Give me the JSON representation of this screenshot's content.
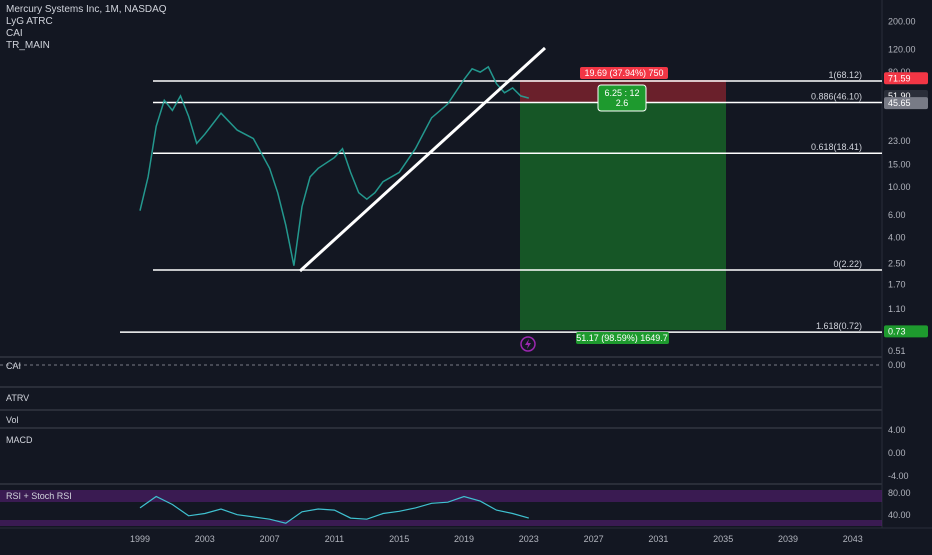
{
  "header": {
    "title": "Mercury Systems Inc, 1M, NASDAQ",
    "indicators": [
      "LyG ATRC",
      "CAI",
      "TR_MAIN"
    ]
  },
  "colors": {
    "background": "#131722",
    "red_zone": "#b22833",
    "green_zone": "#1a8a2a",
    "price_badge_red": "#f23645",
    "price_badge_green": "#1e9a2e",
    "trendline": "#ffffff",
    "rsi": "#3fc1d0",
    "overbought_band": "#5b1f7a"
  },
  "chart_data": {
    "type": "line",
    "x_ticks": [
      "1999",
      "2003",
      "2007",
      "2011",
      "2015",
      "2019",
      "2023",
      "2027",
      "2031",
      "2035",
      "2039",
      "2043"
    ],
    "y_ticks": [
      "200.00",
      "120.00",
      "80.00",
      "51.90",
      "45.65",
      "23.00",
      "15.00",
      "10.00",
      "6.00",
      "4.00",
      "2.50",
      "1.70",
      "1.10",
      "0.51"
    ],
    "y_scale": "log",
    "price_markers": [
      "71.59",
      "51.90",
      "45.65",
      "0.73"
    ],
    "fib_levels": [
      {
        "label": "1(68.12)",
        "value": 68.12
      },
      {
        "label": "0.886(46.10)",
        "value": 46.1
      },
      {
        "label": "0.618(18.41)",
        "value": 18.41
      },
      {
        "label": "0(2.22)",
        "value": 2.22
      },
      {
        "label": "1.618(0.72)",
        "value": 0.72
      }
    ],
    "position_labels": {
      "stop": "19.69 (37.94%) 750",
      "ratio_line1": "6.25 : 12",
      "ratio_line2": "2.6",
      "target": "51.17 (98.59%) 1649.7"
    },
    "price_path": [
      {
        "x": 1999.0,
        "y": 6.5
      },
      {
        "x": 1999.5,
        "y": 12
      },
      {
        "x": 2000.0,
        "y": 30
      },
      {
        "x": 2000.5,
        "y": 48
      },
      {
        "x": 2001.0,
        "y": 40
      },
      {
        "x": 2001.5,
        "y": 52
      },
      {
        "x": 2002.0,
        "y": 36
      },
      {
        "x": 2002.5,
        "y": 22
      },
      {
        "x": 2003.0,
        "y": 26
      },
      {
        "x": 2004.0,
        "y": 38
      },
      {
        "x": 2005.0,
        "y": 28
      },
      {
        "x": 2006.0,
        "y": 24
      },
      {
        "x": 2007.0,
        "y": 14
      },
      {
        "x": 2007.5,
        "y": 9
      },
      {
        "x": 2008.0,
        "y": 5
      },
      {
        "x": 2008.5,
        "y": 2.4
      },
      {
        "x": 2009.0,
        "y": 7
      },
      {
        "x": 2009.5,
        "y": 12
      },
      {
        "x": 2010.0,
        "y": 14
      },
      {
        "x": 2011.0,
        "y": 17
      },
      {
        "x": 2011.5,
        "y": 20
      },
      {
        "x": 2012.0,
        "y": 13
      },
      {
        "x": 2012.5,
        "y": 9
      },
      {
        "x": 2013.0,
        "y": 8
      },
      {
        "x": 2013.5,
        "y": 9
      },
      {
        "x": 2014.0,
        "y": 11
      },
      {
        "x": 2015.0,
        "y": 13
      },
      {
        "x": 2016.0,
        "y": 20
      },
      {
        "x": 2017.0,
        "y": 35
      },
      {
        "x": 2018.0,
        "y": 45
      },
      {
        "x": 2019.0,
        "y": 70
      },
      {
        "x": 2019.5,
        "y": 85
      },
      {
        "x": 2020.0,
        "y": 80
      },
      {
        "x": 2020.5,
        "y": 88
      },
      {
        "x": 2021.0,
        "y": 65
      },
      {
        "x": 2021.5,
        "y": 55
      },
      {
        "x": 2022.0,
        "y": 60
      },
      {
        "x": 2022.5,
        "y": 52
      },
      {
        "x": 2023.0,
        "y": 50
      }
    ],
    "subpanes": [
      {
        "name": "CAI",
        "ticks": [
          "0.00"
        ]
      },
      {
        "name": "ATRV",
        "ticks": []
      },
      {
        "name": "Vol",
        "ticks": []
      },
      {
        "name": "MACD",
        "ticks": [
          "4.00",
          "0.00",
          "-4.00"
        ]
      },
      {
        "name": "RSI + Stoch RSI",
        "ticks": [
          "80.00",
          "40.00"
        ]
      }
    ],
    "rsi_values": [
      {
        "x": 1999.0,
        "y": 62
      },
      {
        "x": 2000.0,
        "y": 82
      },
      {
        "x": 2001.0,
        "y": 68
      },
      {
        "x": 2002.0,
        "y": 48
      },
      {
        "x": 2003.0,
        "y": 52
      },
      {
        "x": 2004.0,
        "y": 60
      },
      {
        "x": 2005.0,
        "y": 50
      },
      {
        "x": 2006.0,
        "y": 46
      },
      {
        "x": 2007.0,
        "y": 42
      },
      {
        "x": 2008.0,
        "y": 35
      },
      {
        "x": 2009.0,
        "y": 55
      },
      {
        "x": 2010.0,
        "y": 60
      },
      {
        "x": 2011.0,
        "y": 58
      },
      {
        "x": 2012.0,
        "y": 44
      },
      {
        "x": 2013.0,
        "y": 42
      },
      {
        "x": 2014.0,
        "y": 52
      },
      {
        "x": 2015.0,
        "y": 56
      },
      {
        "x": 2016.0,
        "y": 62
      },
      {
        "x": 2017.0,
        "y": 70
      },
      {
        "x": 2018.0,
        "y": 72
      },
      {
        "x": 2019.0,
        "y": 82
      },
      {
        "x": 2020.0,
        "y": 74
      },
      {
        "x": 2021.0,
        "y": 58
      },
      {
        "x": 2022.0,
        "y": 52
      },
      {
        "x": 2023.0,
        "y": 44
      }
    ]
  }
}
